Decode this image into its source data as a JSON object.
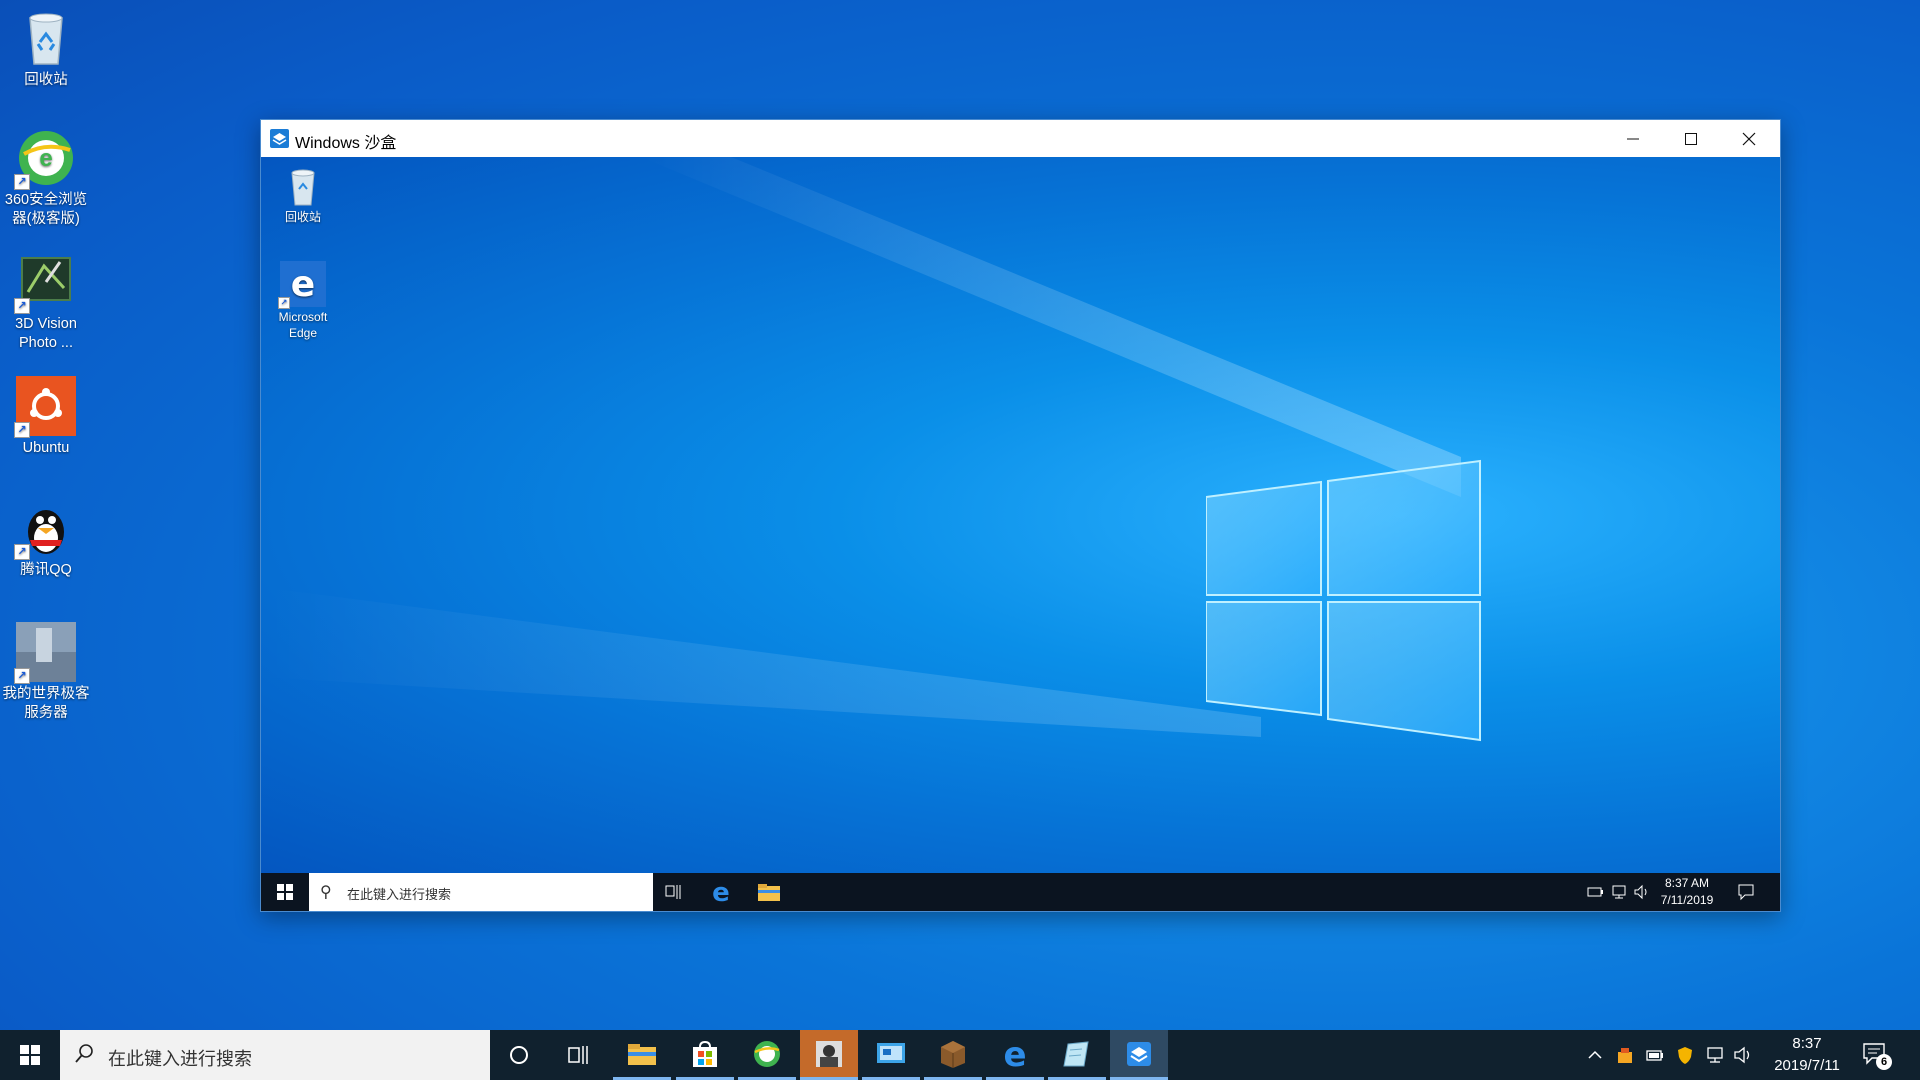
{
  "desktop": {
    "icons": [
      {
        "label": "回收站",
        "icon": "recycle-bin-icon"
      },
      {
        "label": "360安全浏览器(极客版)",
        "icon": "360-browser-icon"
      },
      {
        "label": "3D Vision Photo ...",
        "icon": "3d-vision-photo-icon"
      },
      {
        "label": "Ubuntu",
        "icon": "ubuntu-icon"
      },
      {
        "label": "腾讯QQ",
        "icon": "qq-icon"
      },
      {
        "label": "我的世界极客服务器",
        "icon": "minecraft-server-icon"
      }
    ]
  },
  "sandbox": {
    "title": "Windows 沙盒",
    "desktop_icons": [
      {
        "label": "回收站",
        "icon": "recycle-bin-icon"
      },
      {
        "label": "Microsoft Edge",
        "icon": "edge-icon"
      }
    ],
    "taskbar": {
      "search_placeholder": "在此键入进行搜索",
      "time": "8:37 AM",
      "date": "7/11/2019"
    }
  },
  "taskbar": {
    "search_placeholder": "在此键入进行搜索",
    "time": "8:37",
    "date": "2019/7/11",
    "notification_count": "6",
    "pinned": [
      "cortana-icon",
      "task-view-icon",
      "file-explorer-icon",
      "store-icon",
      "360-browser-icon",
      "photo-app-icon",
      "control-panel-icon",
      "minecraft-icon",
      "edge-icon",
      "notepad-icon",
      "sandbox-icon"
    ]
  },
  "colors": {
    "taskbar_bg": "#10212e",
    "desktop_blue": "#0a74d8",
    "accent": "#7eb6f0"
  }
}
